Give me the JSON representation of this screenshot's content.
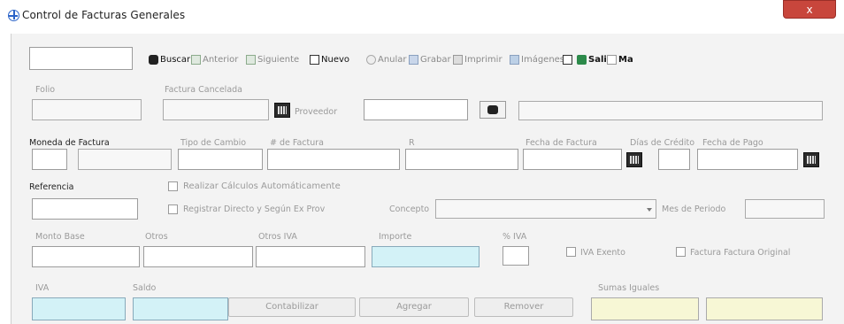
{
  "window": {
    "title": "Control de Facturas Generales",
    "close_label": "x"
  },
  "toolbar": {
    "buscar": "Buscar",
    "anterior": "Anterior",
    "siguiente": "Siguiente",
    "nuevo": "Nuevo",
    "anular": "Anular",
    "grabar": "Grabar",
    "imprimir": "Imprimir",
    "imagenes": "Imágenes",
    "salir": "Salir",
    "ma": "Ma"
  },
  "labels": {
    "folio": "Folio",
    "factura_cancelada": "Factura Cancelada",
    "proveedor": "Proveedor",
    "moneda_factura": "Moneda de Factura",
    "tipo_cambio": "Tipo de Cambio",
    "nro_factura": "# de Factura",
    "rif": "R",
    "fecha_factura": "Fecha de Factura",
    "dias_credito": "Días de Crédito",
    "fecha_pago": "Fecha de Pago",
    "referencia": "Referencia",
    "realizar_calculos": "Realizar Cálculos Automáticamente",
    "registro_directo": "Registrar Directo y Según Ex Prov",
    "concepto": "Concepto",
    "mes_periodo": "Mes de Periodo",
    "monto_base": "Monto Base",
    "otros": "Otros",
    "otros_iva": "Otros IVA",
    "importe": "Importe",
    "pct_iva": "% IVA",
    "iva_exento": "IVA Exento",
    "factura_original": "Factura Factura Original",
    "iva": "IVA",
    "saldo": "Saldo",
    "sumas_iguales": "Sumas Iguales"
  },
  "buttons": {
    "contabilizar": "Contabilizar",
    "agregar": "Agregar",
    "remover": "Remover"
  },
  "colors": {
    "cyan_field": "#d3f2f7",
    "cream_field": "#f7f7d5",
    "close_red": "#c8463c"
  }
}
